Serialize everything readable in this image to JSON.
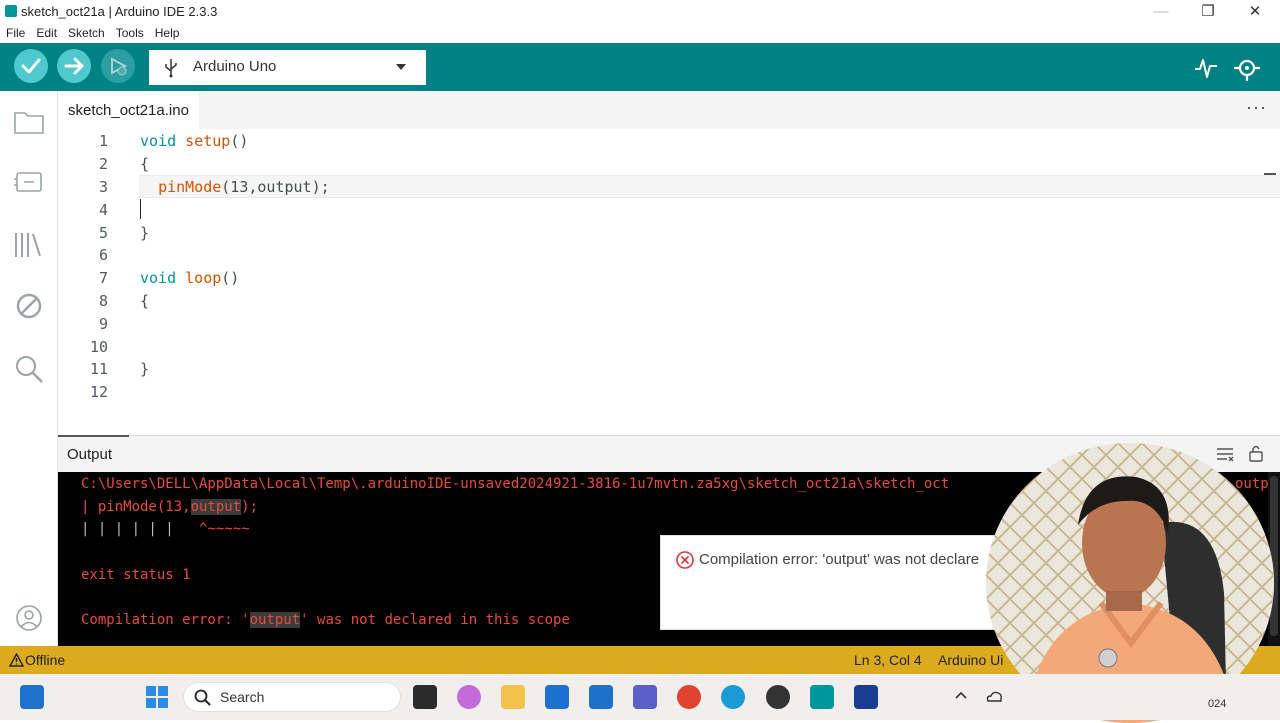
{
  "window": {
    "title": "sketch_oct21a | Arduino IDE 2.3.3",
    "minimize": "—",
    "maximize": "❐",
    "close": "✕"
  },
  "menu": [
    "File",
    "Edit",
    "Sketch",
    "Tools",
    "Help"
  ],
  "toolbar": {
    "board": "Arduino Uno",
    "verify_icon": "check-icon",
    "upload_icon": "arrow-right-icon",
    "debug_icon": "debug-icon",
    "plotter_icon": "serial-plotter-icon",
    "monitor_icon": "serial-monitor-icon",
    "accent": "#008184"
  },
  "tab": {
    "file": "sketch_oct21a.ino",
    "more": "···"
  },
  "editor": {
    "line_numbers": [
      "1",
      "2",
      "3",
      "4",
      "5",
      "6",
      "7",
      "8",
      "9",
      "10",
      "11",
      "12"
    ],
    "line1": {
      "kw": "void",
      "fn": "setup",
      "rest": "()"
    },
    "line2": "{",
    "line3": {
      "fn": "pinMode",
      "rest": "(13,output);"
    },
    "line5": "}",
    "line7": {
      "kw": "void",
      "fn": "loop",
      "rest": "()"
    },
    "line8": "{",
    "line11": "}"
  },
  "output": {
    "title": "Output",
    "path": "C:\\Users\\DELL\\AppData\\Local\\Temp\\.arduinoIDE-unsaved2024921-3816-1u7mvtn.za5xg\\sketch_oct21a\\sketch_oct",
    "path_tail": "outp",
    "code_pre": "pinMode(13,",
    "code_hl": "output",
    "code_post": ");",
    "bars": "| | | | | |",
    "caret": "^~~~~~",
    "exit": "exit status 1",
    "err_pre": "Compilation error: '",
    "err_hl": "output",
    "err_post": "' was not declared in this scope",
    "color": "#e74c3c"
  },
  "toast": {
    "message": "Compilation error: 'output' was not declare"
  },
  "status": {
    "offline": "Offline",
    "position": "Ln 3, Col 4",
    "board": "Arduino Ui"
  },
  "taskbar": {
    "search": "Search",
    "year": "024"
  }
}
